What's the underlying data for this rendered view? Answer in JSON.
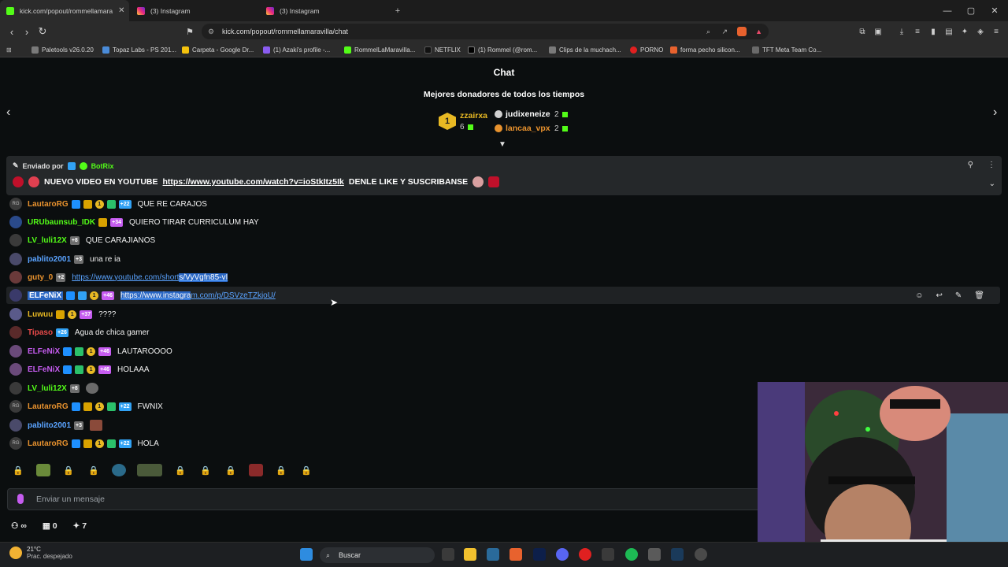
{
  "browser": {
    "tabs": [
      {
        "label": "kick.com/popout/rommellamara",
        "active": true,
        "icon": "kick-icon"
      },
      {
        "label": "(3) Instagram",
        "active": false,
        "icon": "instagram-icon"
      },
      {
        "label": "(3) Instagram",
        "active": false,
        "icon": "instagram-icon"
      }
    ],
    "url": "kick.com/popout/rommellamaravilla/chat",
    "bookmarks": [
      "Paletools v26.0.20",
      "Topaz Labs - PS 201...",
      "Carpeta - Google Dr...",
      "(1) Azaki's profile -...",
      "RommelLaMaravilla...",
      "NETFLIX",
      "(1) Rommel (@rom...",
      "Clips de la muchach...",
      "PORNO",
      "forma pecho silicon...",
      "TFT Meta Team Co..."
    ]
  },
  "chat": {
    "title": "Chat",
    "donors_title": "Mejores donadores de todos los tiempos",
    "donors": [
      {
        "rank": "1",
        "name": "zzairxa",
        "count": "6",
        "color": "#e8b923"
      },
      {
        "name": "judixeneize",
        "count": "2",
        "color": "#ffffff"
      },
      {
        "name": "lancaa_vpx",
        "count": "2",
        "color": "#e8922e"
      }
    ],
    "pinned": {
      "sent_by_label": "Enviado por",
      "sender": "BotRix",
      "message": "NUEVO VIDEO EN YOUTUBE",
      "link": "https://www.youtube.com/watch?v=ioStkItz5Ik",
      "suffix": "DENLE LIKE Y SUSCRIBANSE"
    },
    "messages": [
      {
        "user": "LautaroRG",
        "color": "#e8922e",
        "badges": [
          "ver",
          "crown",
          "coin",
          "gift",
          "+22"
        ],
        "text": "QUE RE CARAJOS"
      },
      {
        "user": "URUbaunsub_IDK",
        "color": "#53fc18",
        "badges": [
          "crown",
          "+34"
        ],
        "text": "QUIERO TIRAR CURRICULUM HAY"
      },
      {
        "user": "LV_luli12X",
        "color": "#53fc18",
        "badges": [
          "+8"
        ],
        "text": "QUE CARAJIANOS"
      },
      {
        "user": "pablito2001",
        "color": "#5aa3ff",
        "badges": [
          "+3"
        ],
        "text": "una re ia"
      },
      {
        "user": "guty_0",
        "color": "#e8922e",
        "badges": [
          "+2"
        ],
        "link_a": "https://www.youtube.com/short",
        "link_b": "s/VyVgfn85-vI"
      },
      {
        "user": "ELFeNiX",
        "color": "#ffffff",
        "badges": [
          "ver",
          "gift",
          "coin",
          "+46"
        ],
        "link_a": "https://www.instagra",
        "link_b": "m.com/p/DSVzeTZkjoU/"
      },
      {
        "user": "Luwuu",
        "color": "#e8b923",
        "badges": [
          "crown",
          "coin",
          "+37"
        ],
        "text": "????"
      },
      {
        "user": "Tipaso",
        "color": "#e84a4a",
        "badges": [
          "+26"
        ],
        "text": "Agua de chica gamer"
      },
      {
        "user": "ELFeNiX",
        "color": "#c65cf0",
        "badges": [
          "ver",
          "gift",
          "coin",
          "+46"
        ],
        "text": "LAUTAROOOO"
      },
      {
        "user": "ELFeNiX",
        "color": "#c65cf0",
        "badges": [
          "ver",
          "gift",
          "coin",
          "+46"
        ],
        "text": "HOLAAA"
      },
      {
        "user": "LV_luli12X",
        "color": "#53fc18",
        "badges": [
          "+8"
        ],
        "text": ""
      },
      {
        "user": "LautaroRG",
        "color": "#e8922e",
        "badges": [
          "ver",
          "crown",
          "coin",
          "gift",
          "+22"
        ],
        "text": "FWNIX"
      },
      {
        "user": "pablito2001",
        "color": "#5aa3ff",
        "badges": [
          "+3"
        ],
        "text": ""
      },
      {
        "user": "LautaroRG",
        "color": "#e8922e",
        "badges": [
          "ver",
          "crown",
          "coin",
          "gift",
          "+22"
        ],
        "text": "HOLA"
      }
    ],
    "input_placeholder": "Enviar un mensaje",
    "stats": {
      "infinity": "∞",
      "shop": "0",
      "points": "7"
    }
  },
  "taskbar": {
    "temperature": "21°C",
    "weather": "Prac. despejado",
    "search": "Buscar"
  }
}
